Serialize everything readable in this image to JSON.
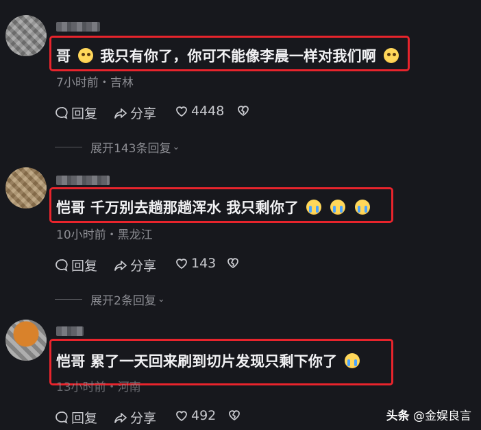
{
  "comments": [
    {
      "text_main": "哥",
      "text_rest": "我只有你了，你可不能像李晨一样对我们啊",
      "meta": "7小时前・吉林",
      "reply_label": "回复",
      "share_label": "分享",
      "likes": "4448",
      "expand_label": "展开143条回复"
    },
    {
      "text_main": "恺哥 千万别去趟那趟浑水 我只剩你了",
      "meta": "10小时前・黑龙江",
      "reply_label": "回复",
      "share_label": "分享",
      "likes": "143",
      "expand_label": "展开2条回复"
    },
    {
      "text_main": "恺哥 累了一天回来刷到切片发现只剩下你了",
      "meta": "13小时前・河南",
      "reply_label": "回复",
      "share_label": "分享",
      "likes": "492"
    }
  ],
  "watermark": {
    "brand": "头条",
    "account": "@金娱良言"
  },
  "icons": {
    "reply": "comment-bubble-icon",
    "share": "share-arrow-icon",
    "like": "heart-icon",
    "dislike": "broken-heart-icon",
    "expand": "chevron-down-icon"
  },
  "colors": {
    "background": "#17181d",
    "highlight_border": "#e8242c"
  }
}
